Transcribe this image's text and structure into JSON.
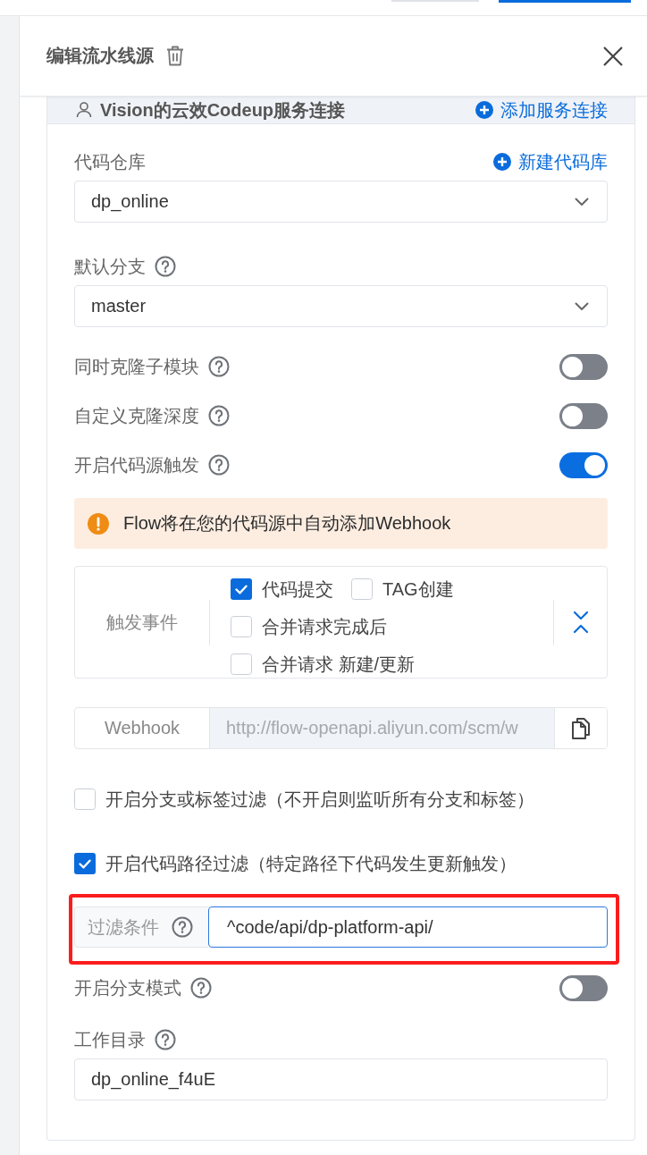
{
  "header": {
    "title": "编辑流水线源"
  },
  "connection": {
    "name": "Vision的云效Codeup服务连接",
    "add_link": "添加服务连接"
  },
  "fields": [
    {
      "kind": "select",
      "label": "代码仓库",
      "action": "新建代码库",
      "value": "dp_online"
    },
    {
      "kind": "select",
      "label": "默认分支",
      "help": true,
      "value": "master"
    },
    {
      "kind": "toggle",
      "label": "同时克隆子模块",
      "help": true,
      "on": false
    },
    {
      "kind": "toggle",
      "label": "自定义克隆深度",
      "help": true,
      "on": false
    },
    {
      "kind": "toggle",
      "label": "开启代码源触发",
      "help": true,
      "on": true
    },
    {
      "kind": "alert",
      "text": "Flow将在您的代码源中自动添加Webhook"
    },
    {
      "kind": "events",
      "label": "触发事件",
      "options": [
        {
          "label": "代码提交",
          "checked": true
        },
        {
          "label": "TAG创建",
          "checked": false
        },
        {
          "label": "合并请求完成后",
          "checked": false
        },
        {
          "label": "合并请求 新建/更新",
          "checked": false
        }
      ]
    },
    {
      "kind": "webhook",
      "label": "Webhook",
      "value": "http://flow-openapi.aliyun.com/scm/w",
      "disabled": true
    },
    {
      "kind": "checkbox",
      "label": "开启分支或标签过滤（不开启则监听所有分支和标签）",
      "checked": false
    },
    {
      "kind": "checkbox",
      "label": "开启代码路径过滤（特定路径下代码发生更新触发）",
      "checked": true
    },
    {
      "kind": "filter",
      "label": "过滤条件",
      "help": true,
      "value": "^code/api/dp-platform-api/",
      "focused": true,
      "highlighted": true
    },
    {
      "kind": "toggle",
      "label": "开启分支模式",
      "help": true,
      "on": false
    },
    {
      "kind": "input",
      "label": "工作目录",
      "help": true,
      "value": "dp_online_f4uE"
    }
  ]
}
